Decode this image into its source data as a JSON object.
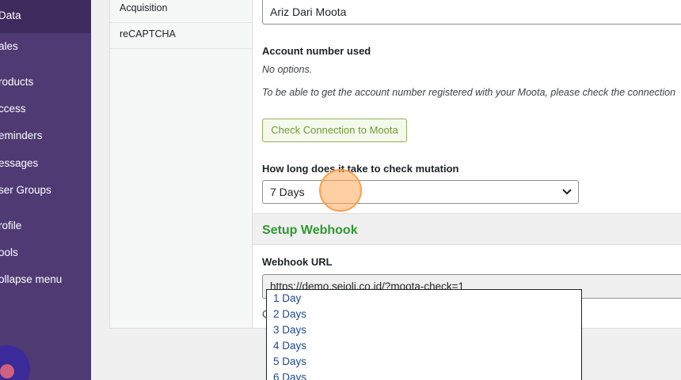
{
  "sidebar": {
    "items": [
      "Data",
      "ales",
      "roducts",
      "ccess",
      "eminders",
      "essages",
      "ser Groups",
      "rofile",
      "ools",
      "ollapse menu"
    ]
  },
  "tabs": [
    "Acquisition",
    "reCAPTCHA"
  ],
  "form": {
    "account_name_value": "Ariz Dari Moota",
    "account_number_label": "Account number used",
    "no_options": "No options.",
    "help_text": "To be able to get the account number registered with your Moota, please check the connection",
    "check_button": "Check Connection to Moota",
    "mutation_label": "How long does it take to check mutation",
    "mutation_value": "7 Days"
  },
  "webhook": {
    "section_title": "Setup Webhook",
    "url_label": "Webhook URL",
    "url_value": "https://demo.sejoli.co.id/?moota-check=1",
    "below_text": "C"
  },
  "dropdown": {
    "options": [
      "1 Day",
      "2 Days",
      "3 Days",
      "4 Days",
      "5 Days",
      "6 Days"
    ]
  },
  "colors": {
    "sidebar_bg": "#4f3a73",
    "accent_green": "#2e9a2e",
    "option_text": "#1f4a8a"
  }
}
